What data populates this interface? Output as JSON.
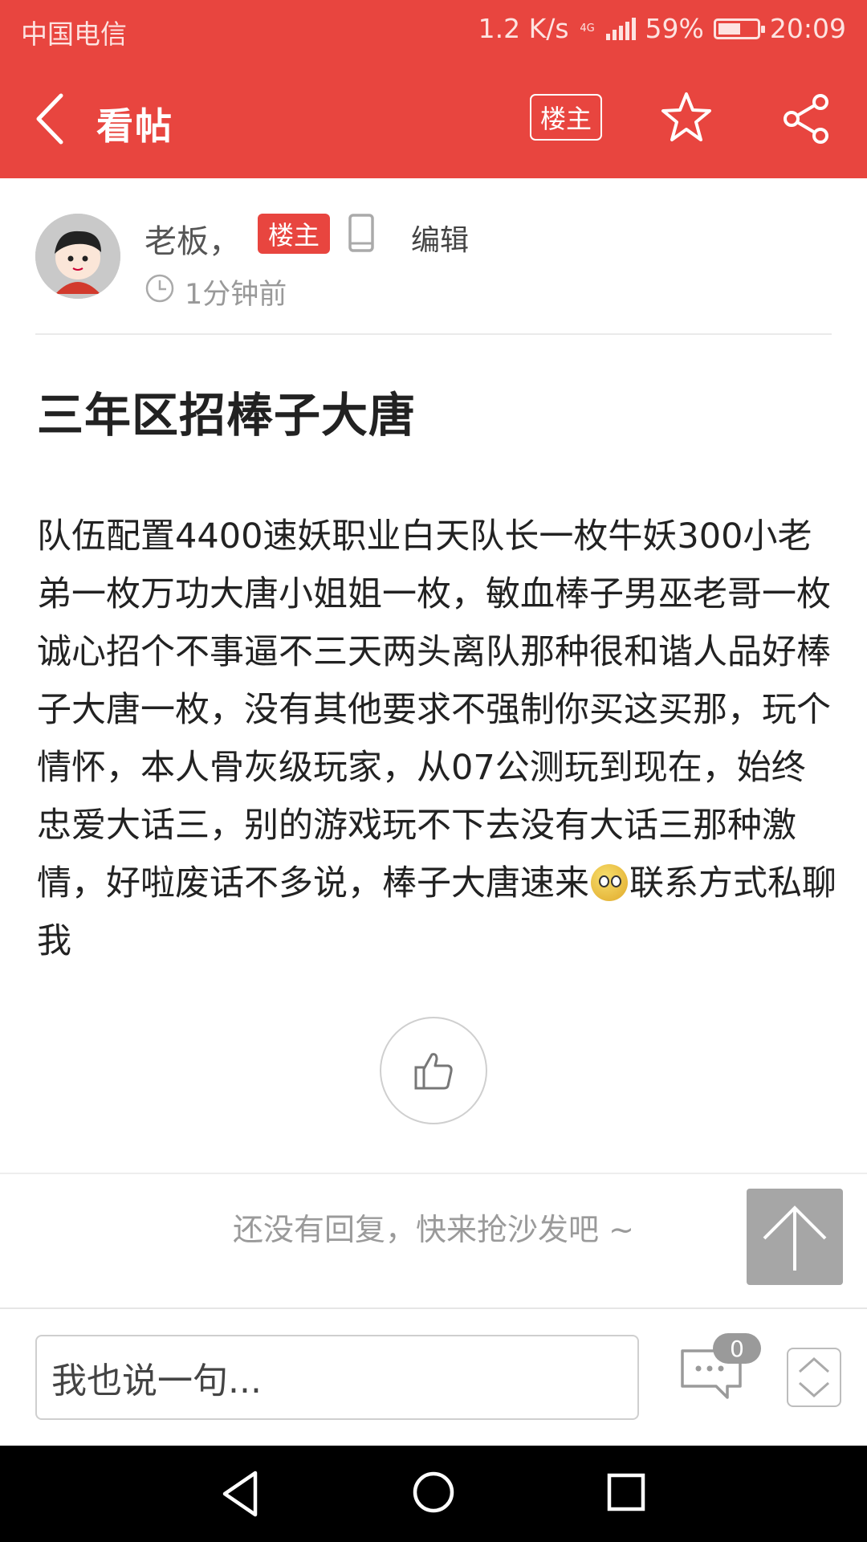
{
  "status_bar": {
    "carrier": "中国电信",
    "speed": "1.2 K/s",
    "network": "4G",
    "battery": "59%",
    "battery_level": 0.59,
    "time": "20:09"
  },
  "header": {
    "title": "看帖",
    "owner_filter_label": "楼主",
    "icons": [
      "back-icon",
      "star-icon",
      "share-icon"
    ]
  },
  "author": {
    "name": "老板，",
    "badge": "楼主",
    "edit_label": "编辑",
    "time": "1分钟前",
    "icons": [
      "phone-icon",
      "clock-icon"
    ]
  },
  "post": {
    "title": "三年区招棒子大唐",
    "body_part1": "队伍配置4400速妖职业白天队长一枚牛妖300小老弟一枚万功大唐小姐姐一枚，敏血棒子男巫老哥一枚诚心招个不事逼不三天两头离队那种很和谐人品好棒子大唐一枚，没有其他要求不强制你买这买那，玩个情怀，本人骨灰级玩家，从07公测玩到现在，始终忠爱大话三，别的游戏玩不下去没有大话三那种激情，好啦废话不多说，棒子大唐速来",
    "body_part2": "联系方式私聊我",
    "emoji": "eyes-emoji"
  },
  "replies": {
    "empty_text": "还没有回复，快来抢沙发吧 ~"
  },
  "bottom_bar": {
    "reply_placeholder": "我也说一句...",
    "comment_count": "0"
  },
  "colors": {
    "brand_red": "#e8453f",
    "text_dark": "#222222",
    "text_gray": "#999999"
  }
}
